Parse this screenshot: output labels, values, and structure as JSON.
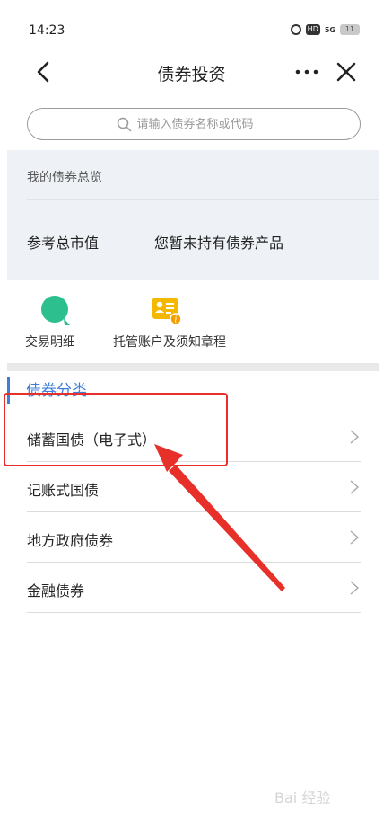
{
  "status": {
    "time": "14:23",
    "icons": [
      "alarm-icon",
      "hd-icon",
      "5g-signal-icon",
      "battery-icon"
    ],
    "hd": "HD",
    "signal": "5G",
    "battery": "11"
  },
  "nav": {
    "title": "债券投资",
    "back_icon": "chevron-left-icon",
    "more_icon": "more-icon",
    "close_icon": "close-icon"
  },
  "search": {
    "placeholder": "请输入债券名称或代码",
    "icon": "search-icon"
  },
  "overview": {
    "header": "我的债券总览",
    "market_value_label": "参考总市值",
    "market_value_text": "您暂未持有债券产品"
  },
  "quick_actions": [
    {
      "label": "交易明细",
      "icon": "magnifier-icon",
      "color": "#2ebf8f"
    },
    {
      "label": "托管账户及须知章程",
      "icon": "id-card-icon",
      "color": "#f5b800"
    }
  ],
  "category": {
    "title": "债券分类",
    "accent": "#3d7ed8",
    "items": [
      {
        "label": "储蓄国债（电子式）"
      },
      {
        "label": "记账式国债"
      },
      {
        "label": "地方政府债券"
      },
      {
        "label": "金融债券"
      }
    ]
  },
  "annotation": {
    "color": "#e8302a"
  },
  "watermark": "Bai 经验"
}
